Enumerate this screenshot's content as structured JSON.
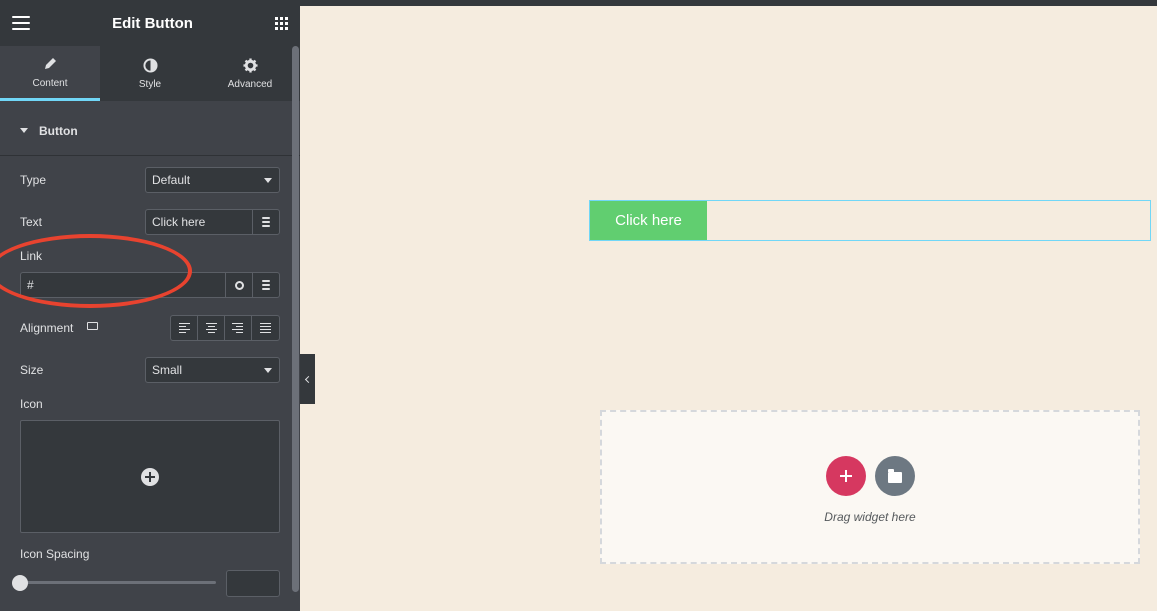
{
  "panel": {
    "title": "Edit Button",
    "tabs": [
      {
        "label": "Content",
        "icon": "pencil-icon",
        "active": true
      },
      {
        "label": "Style",
        "icon": "half-circle-icon",
        "active": false
      },
      {
        "label": "Advanced",
        "icon": "gear-icon",
        "active": false
      }
    ],
    "section": {
      "label": "Button"
    },
    "fields": {
      "type": {
        "label": "Type",
        "value": "Default"
      },
      "text": {
        "label": "Text",
        "value": "Click here"
      },
      "link": {
        "label": "Link",
        "value": "#"
      },
      "alignment": {
        "label": "Alignment",
        "options": [
          "left",
          "center",
          "right",
          "justify"
        ]
      },
      "size": {
        "label": "Size",
        "value": "Small"
      },
      "icon": {
        "label": "Icon"
      },
      "icon_spacing": {
        "label": "Icon Spacing",
        "value": ""
      }
    }
  },
  "canvas": {
    "button_label": "Click here",
    "dropzone_text": "Drag widget here"
  },
  "colors": {
    "panel_bg": "#404349",
    "panel_dark": "#34383c",
    "accent_tab": "#71d7f7",
    "cta_green": "#61ce70",
    "add_red": "#d63860",
    "folder_gray": "#6d7882",
    "annotation_red": "#e8432f",
    "canvas_bg": "#f5ecdf"
  }
}
